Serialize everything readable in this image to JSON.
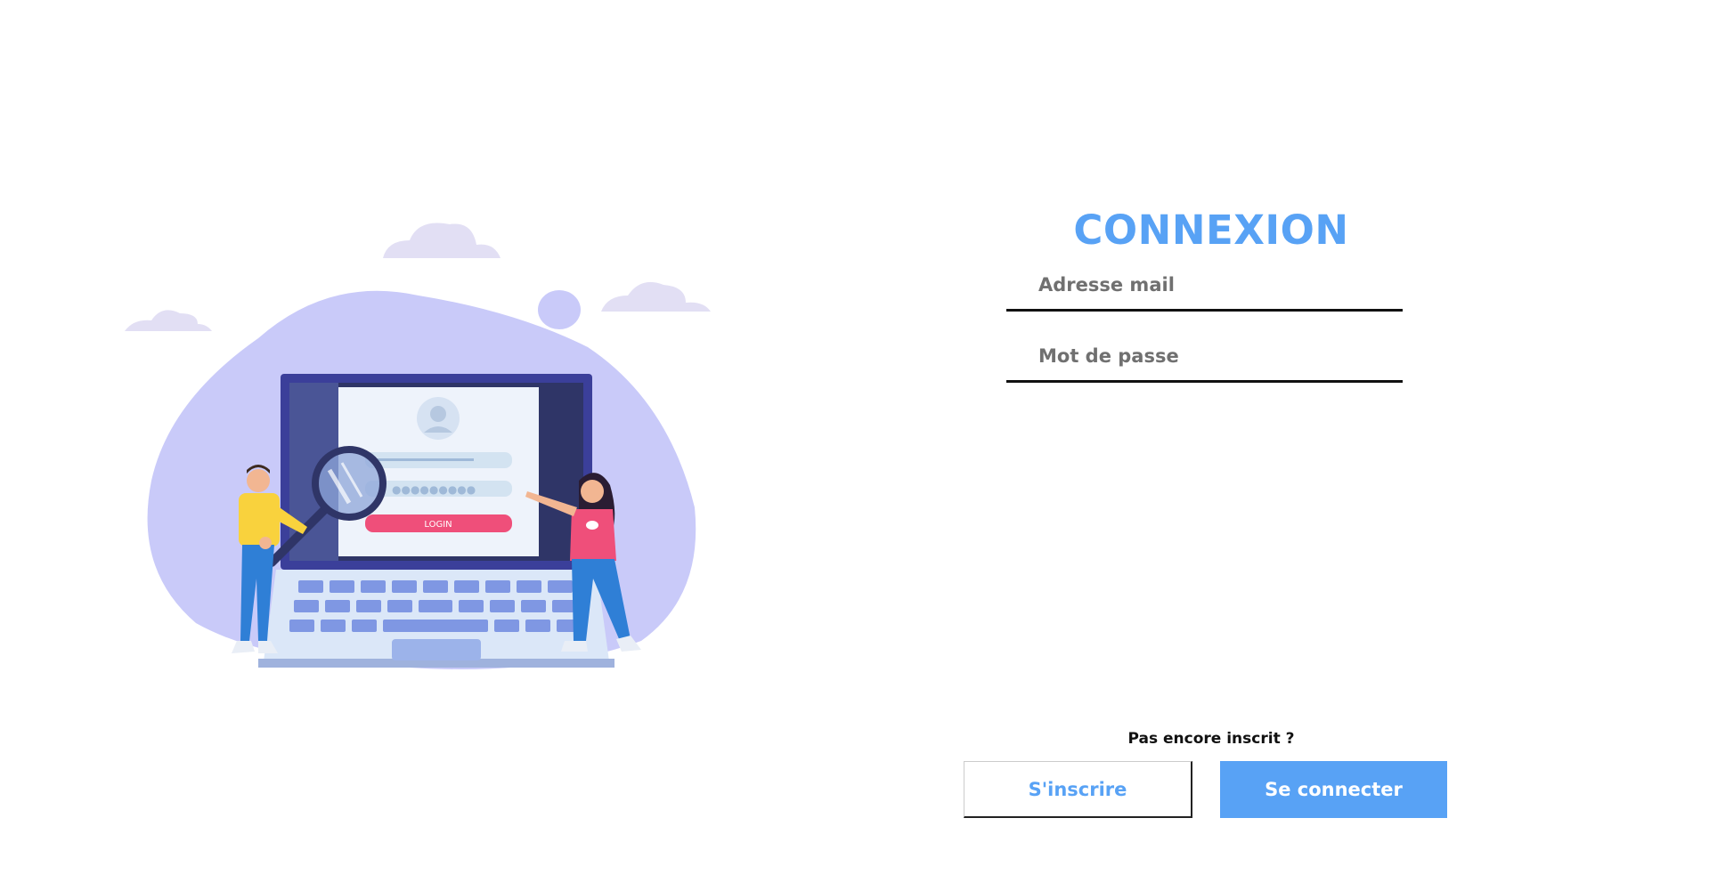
{
  "login": {
    "title": "CONNEXION",
    "email_placeholder": "Adresse mail",
    "password_placeholder": "Mot de passe",
    "signup_prompt": "Pas encore inscrit ?",
    "signup_label": "S'inscrire",
    "submit_label": "Se connecter"
  },
  "illustration": {
    "screen_button_text": "LOGIN"
  },
  "colors": {
    "accent": "#58a2f5",
    "blob": "#c9caf9",
    "cloud": "#e2dff4",
    "laptop_frame": "#3b3f9a",
    "login_button": "#ef4f7a"
  }
}
